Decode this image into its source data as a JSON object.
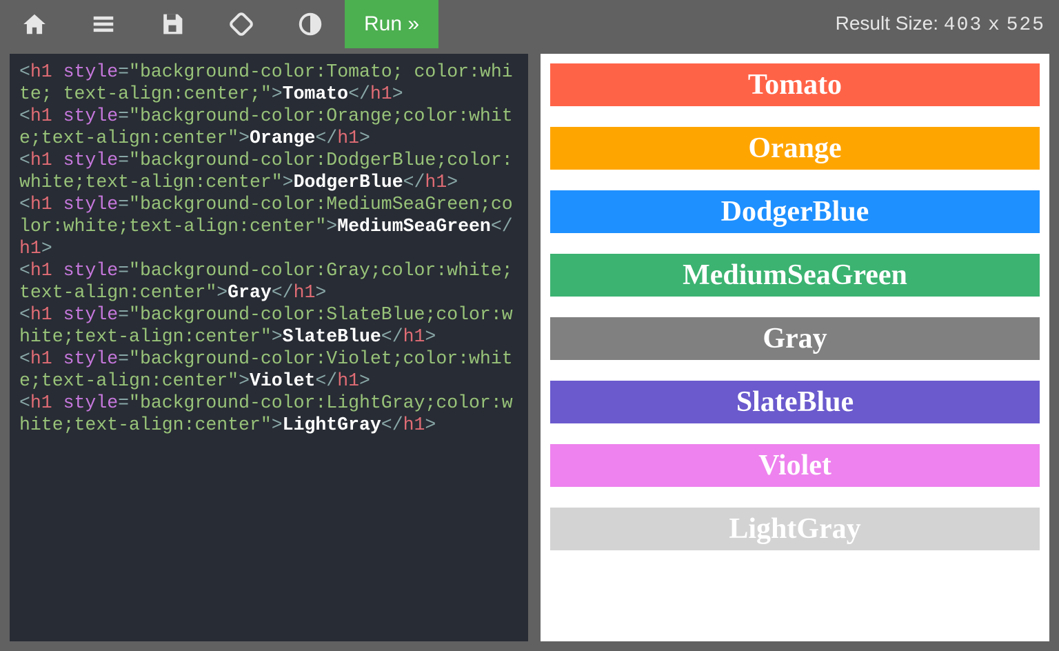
{
  "toolbar": {
    "run_label": "Run »",
    "result_label": "Result Size:",
    "result_w": "403",
    "result_sep": "x",
    "result_h": "525"
  },
  "colors": [
    {
      "name": "Tomato",
      "bg": "#ff6347"
    },
    {
      "name": "Orange",
      "bg": "#ffa500"
    },
    {
      "name": "DodgerBlue",
      "bg": "#1e90ff"
    },
    {
      "name": "MediumSeaGreen",
      "bg": "#3cb371"
    },
    {
      "name": "Gray",
      "bg": "#808080"
    },
    {
      "name": "SlateBlue",
      "bg": "#6a5acd"
    },
    {
      "name": "Violet",
      "bg": "#ee82ee"
    },
    {
      "name": "LightGray",
      "bg": "#d3d3d3"
    }
  ],
  "code_lines": [
    {
      "color": "Tomato",
      "style_segments": [
        "background-color:Tomato; color:white; text-align:center;"
      ]
    },
    {
      "color": "Orange",
      "style_segments": [
        "background-color:Orange;color:white;text-align:center"
      ]
    },
    {
      "color": "DodgerBlue",
      "style_segments": [
        "background-color:DodgerBlue;color:white;text-align:center"
      ]
    },
    {
      "color": "MediumSeaGreen",
      "style_segments": [
        "background-color:MediumSeaGreen;color:white;text-align:center"
      ]
    },
    {
      "color": "Gray",
      "style_segments": [
        "background-color:Gray;color:white;text-align:center"
      ]
    },
    {
      "color": "SlateBlue",
      "style_segments": [
        "background-color:SlateBlue;color:white;text-align:center"
      ]
    },
    {
      "color": "Violet",
      "style_segments": [
        "background-color:Violet;color:white;text-align:center"
      ]
    },
    {
      "color": "LightGray",
      "style_segments": [
        "background-color:LightGray;color:white;text-align:center"
      ]
    }
  ]
}
